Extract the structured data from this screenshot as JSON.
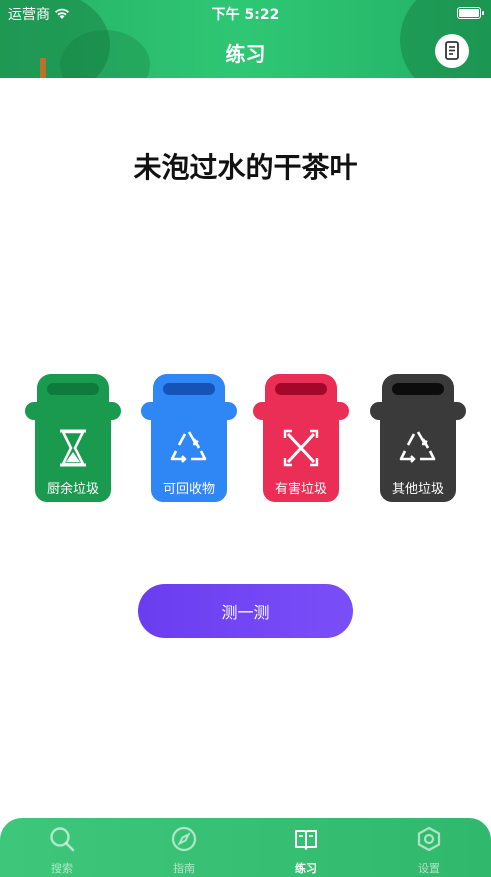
{
  "status_bar": {
    "carrier": "运营商",
    "time": "下午 5:22"
  },
  "nav": {
    "title": "练习",
    "doc_icon": "document-icon"
  },
  "question": {
    "text": "未泡过水的干茶叶"
  },
  "bins": [
    {
      "label": "厨余垃圾",
      "icon": "hourglass-icon",
      "color": "#1a9a4f",
      "dark": "#0e7a3b"
    },
    {
      "label": "可回收物",
      "icon": "recycle-icon",
      "color": "#2f86f5",
      "dark": "#1553b8"
    },
    {
      "label": "有害垃圾",
      "icon": "hazard-x-icon",
      "color": "#ea2e55",
      "dark": "#a3082a"
    },
    {
      "label": "其他垃圾",
      "icon": "recycle-icon",
      "color": "#3a3a3a",
      "dark": "#0c0c0c"
    }
  ],
  "test_button": {
    "label": "测一测"
  },
  "tabs": [
    {
      "label": "搜索",
      "icon": "search-icon",
      "active": false
    },
    {
      "label": "指南",
      "icon": "compass-icon",
      "active": false
    },
    {
      "label": "练习",
      "icon": "book-icon",
      "active": true
    },
    {
      "label": "设置",
      "icon": "hexagon-gear-icon",
      "active": false
    }
  ]
}
